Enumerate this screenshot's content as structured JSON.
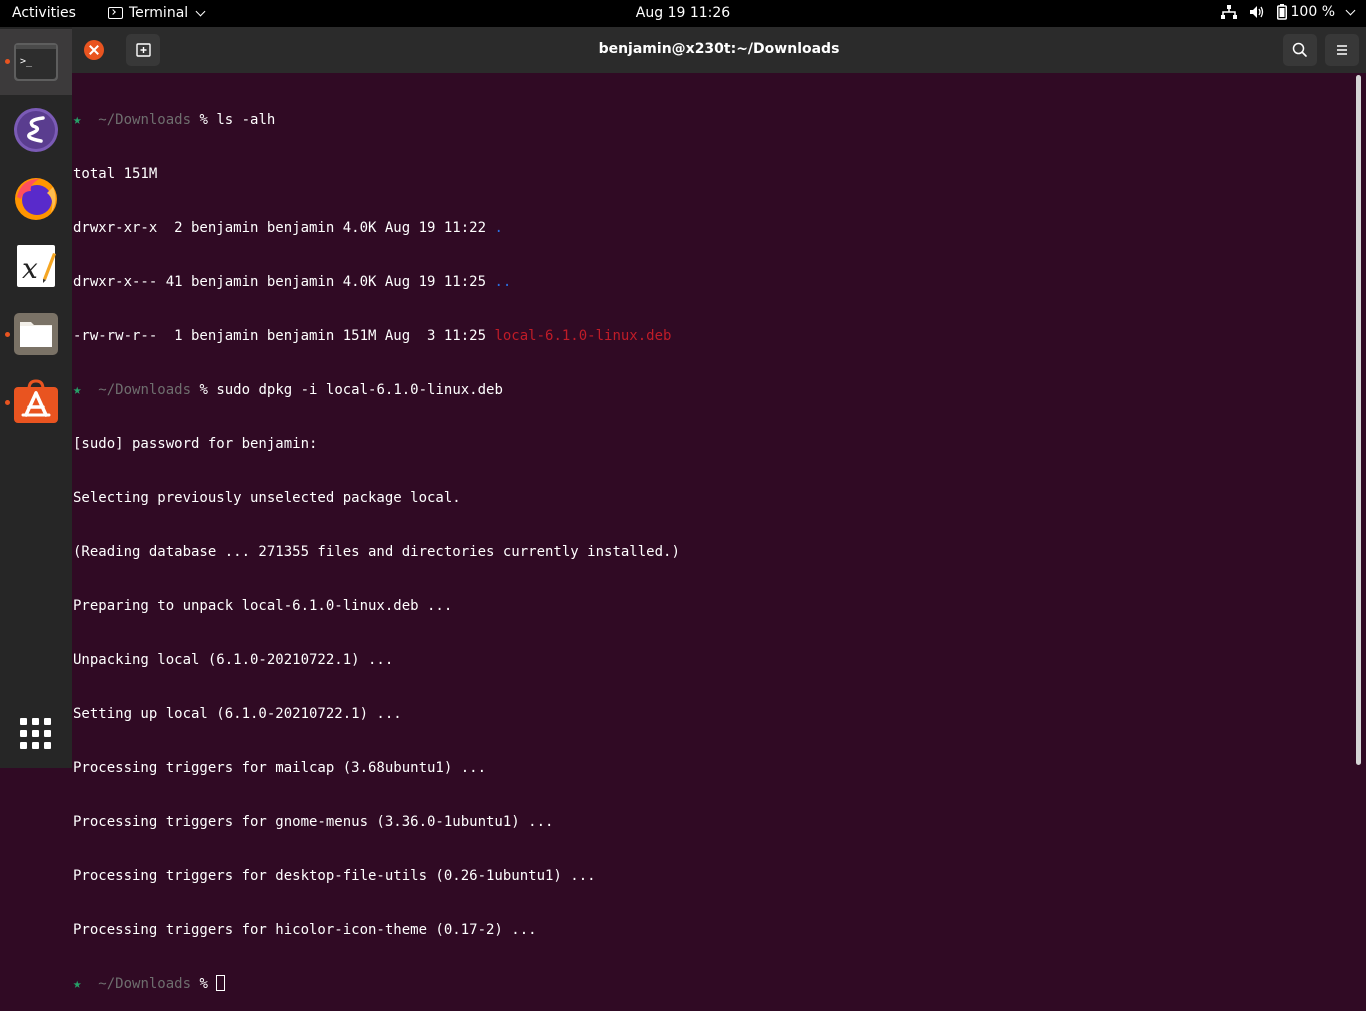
{
  "topbar": {
    "activities": "Activities",
    "app_menu": "Terminal",
    "clock": "Aug 19  11:26",
    "battery_percent": "100 %",
    "icons": [
      "network-icon",
      "volume-icon",
      "battery-icon",
      "chevron-down-icon"
    ]
  },
  "dock": {
    "items": [
      {
        "name": "Terminal",
        "icon": "terminal-icon",
        "running": true,
        "active": true
      },
      {
        "name": "Emacs",
        "icon": "emacs-icon",
        "running": false
      },
      {
        "name": "Firefox",
        "icon": "firefox-icon",
        "running": false
      },
      {
        "name": "Xournal",
        "icon": "xournal-icon",
        "running": false
      },
      {
        "name": "Files",
        "icon": "files-icon",
        "running": true
      },
      {
        "name": "Ubuntu Software",
        "icon": "software-center-icon",
        "running": true
      }
    ],
    "show_apps_icon": "apps-grid-icon"
  },
  "window": {
    "title": "benjamin@x230t:~/Downloads"
  },
  "terminal": {
    "prompt_star": "★",
    "prompt_dir": "~/Downloads",
    "prompt_symbol": "%",
    "cmd1": " ls -alh",
    "total": "total 151M",
    "ls_rows": [
      {
        "perms": "drwxr-xr-x  2 benjamin benjamin 4.0K Aug 19 11:22 ",
        "name": "."
      },
      {
        "perms": "drwxr-x--- 41 benjamin benjamin 4.0K Aug 19 11:25 ",
        "name": ".."
      },
      {
        "perms": "-rw-rw-r--  1 benjamin benjamin 151M Aug  3 11:25 ",
        "name": "local-6.1.0-linux.deb"
      }
    ],
    "cmd2": " sudo dpkg -i local-6.1.0-linux.deb",
    "output": [
      "[sudo] password for benjamin:",
      "Selecting previously unselected package local.",
      "(Reading database ... 271355 files and directories currently installed.)",
      "Preparing to unpack local-6.1.0-linux.deb ...",
      "Unpacking local (6.1.0-20210722.1) ...",
      "Setting up local (6.1.0-20210722.1) ...",
      "Processing triggers for mailcap (3.68ubuntu1) ...",
      "Processing triggers for gnome-menus (3.36.0-1ubuntu1) ...",
      "Processing triggers for desktop-file-utils (0.26-1ubuntu1) ...",
      "Processing triggers for hicolor-icon-theme (0.17-2) ..."
    ]
  },
  "colors": {
    "terminal_bg": "#300a24",
    "accent": "#e95420",
    "prompt_star": "#26a269",
    "prompt_dir": "#6e6e6e",
    "dir_color": "#2a6fe0",
    "deb_color": "#c01c28"
  }
}
